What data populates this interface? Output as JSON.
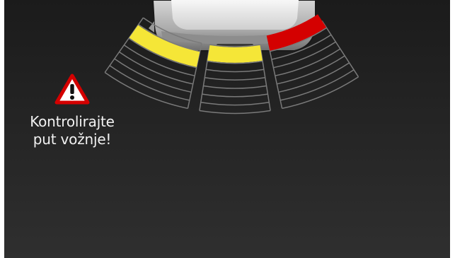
{
  "warning": {
    "icon": "warning-triangle-icon",
    "line1": "Kontrolirajte",
    "line2": "put vožnje!"
  },
  "sensors": {
    "zone_count": 3,
    "rings_per_zone": 9,
    "ring_color": "#7a7a7a",
    "left": {
      "active_ring": 3,
      "color": "#f5e637"
    },
    "center": {
      "active_ring": 2,
      "color": "#f5e637"
    },
    "right": {
      "active_ring": 1,
      "color": "#d40000"
    }
  },
  "vehicle": {
    "icon": "car-rear-icon"
  }
}
